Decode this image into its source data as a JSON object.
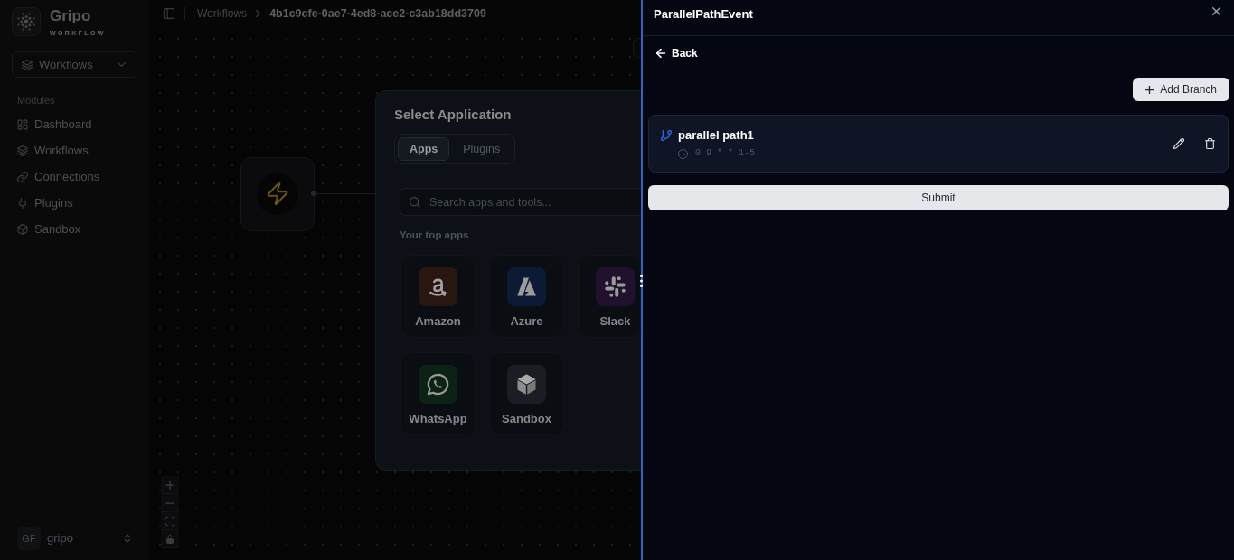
{
  "sidebar": {
    "brand": {
      "name": "Gripo",
      "tagline": "WORKFLOW"
    },
    "workspace_select": {
      "value": "Workflows"
    },
    "section_label": "Modules",
    "items": [
      {
        "label": "Dashboard",
        "kind": "grid"
      },
      {
        "label": "Workflows",
        "kind": "layers"
      },
      {
        "label": "Connections",
        "kind": "link"
      },
      {
        "label": "Plugins",
        "kind": "plug"
      },
      {
        "label": "Sandbox",
        "kind": "box"
      }
    ],
    "user": {
      "initials": "GF",
      "name": "gripo"
    }
  },
  "breadcrumb": [
    {
      "label": "Workflows"
    },
    {
      "label": "4b1c9cfe-0ae7-4ed8-ace2-c3ab18dd3709"
    }
  ],
  "app_picker": {
    "title": "Select Application",
    "tabs": [
      {
        "label": "Apps",
        "selected": true
      },
      {
        "label": "Plugins",
        "selected": false
      }
    ],
    "search": {
      "placeholder": "Search apps and tools..."
    },
    "section_label": "Your top apps",
    "apps": [
      {
        "name": "Amazon",
        "kind": "amazon",
        "color": "#2a1611"
      },
      {
        "name": "Azure",
        "kind": "azure",
        "color": "#0d1a36"
      },
      {
        "name": "Slack",
        "kind": "slack",
        "color": "#21112f"
      },
      {
        "name": "WhatsApp",
        "kind": "whatsapp",
        "color": "#0c2215"
      },
      {
        "name": "Sandbox",
        "kind": "sandbox",
        "color": "#1a1d24"
      }
    ]
  },
  "side_panel": {
    "title": "ParallelPathEvent",
    "back_label": "Back",
    "add_button": "Add Branch",
    "branches": [
      {
        "name": "parallel path1",
        "schedule": "0 9 * * 1-5"
      }
    ],
    "submit_label": "Submit"
  }
}
